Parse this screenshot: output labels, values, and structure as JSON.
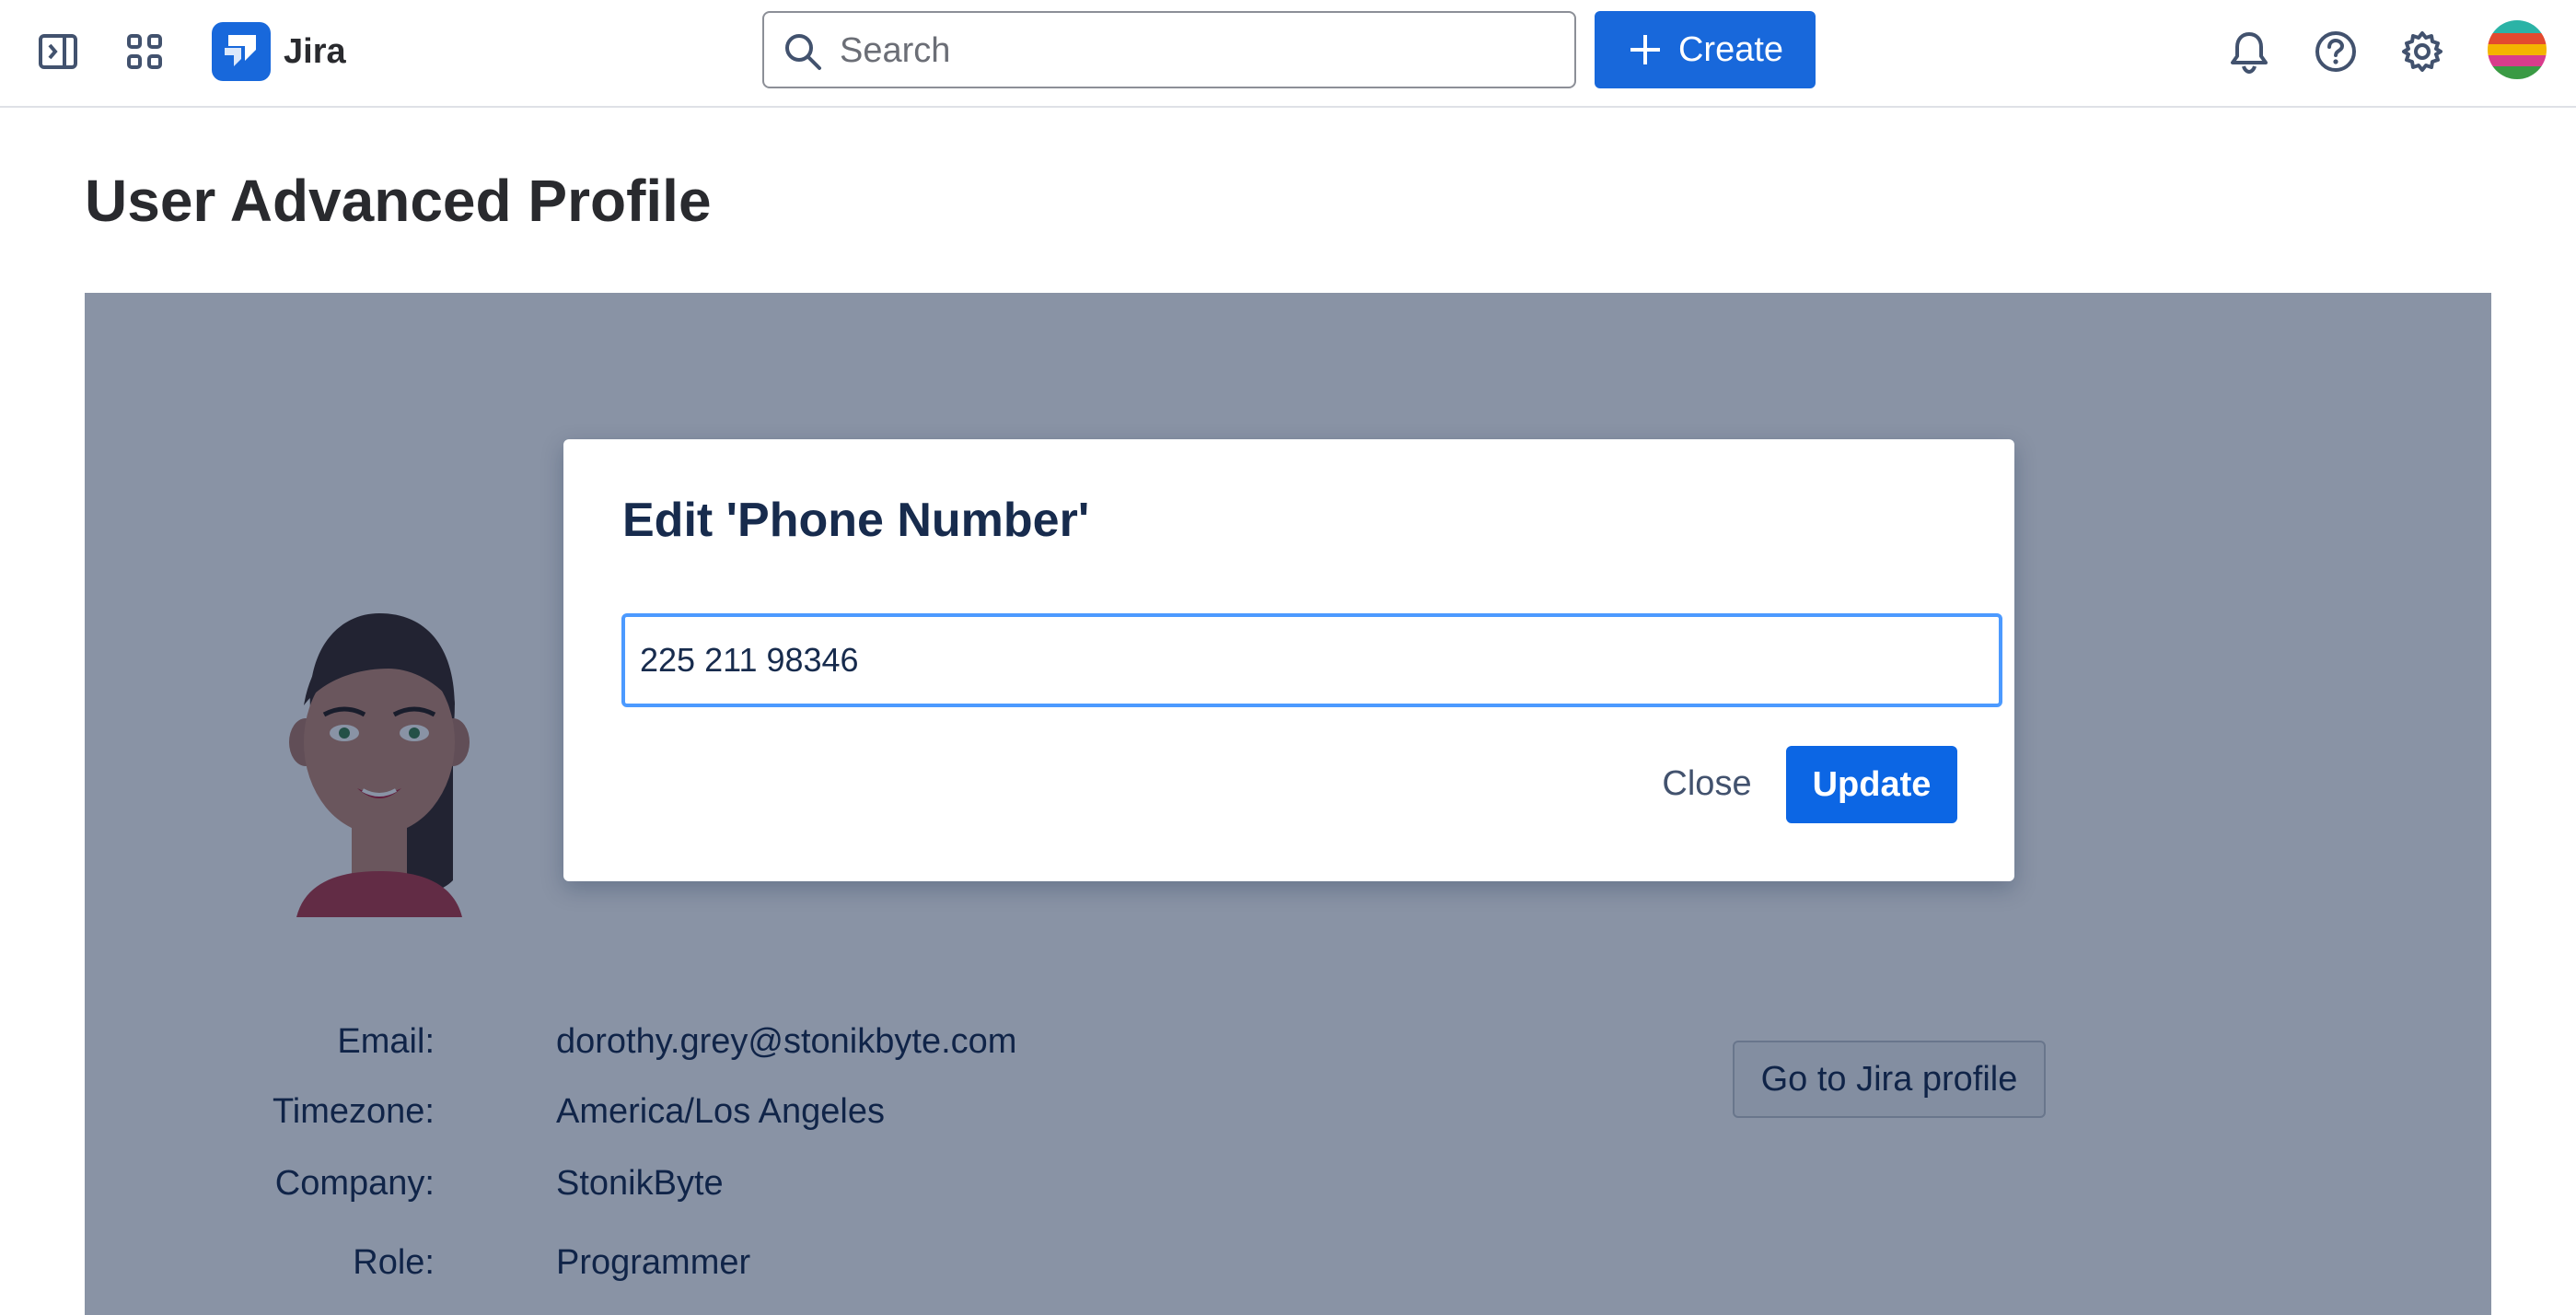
{
  "topbar": {
    "app_name": "Jira",
    "search_placeholder": "Search",
    "create_label": "Create"
  },
  "page": {
    "title": "User Advanced Profile"
  },
  "profile": {
    "fields": [
      {
        "label": "Email:",
        "value": "dorothy.grey@stonikbyte.com"
      },
      {
        "label": "Timezone:",
        "value": "America/Los Angeles"
      },
      {
        "label": "Company:",
        "value": "StonikByte"
      },
      {
        "label": "Role:",
        "value": "Programmer"
      }
    ],
    "jira_profile_button": "Go to Jira profile"
  },
  "modal": {
    "title": "Edit 'Phone Number'",
    "input_value": "225 211 98346",
    "close_label": "Close",
    "update_label": "Update"
  },
  "colors": {
    "brand_blue": "#1868db",
    "overlay": "rgba(9,30,66,0.48)",
    "focus_border": "#4c9aff"
  }
}
